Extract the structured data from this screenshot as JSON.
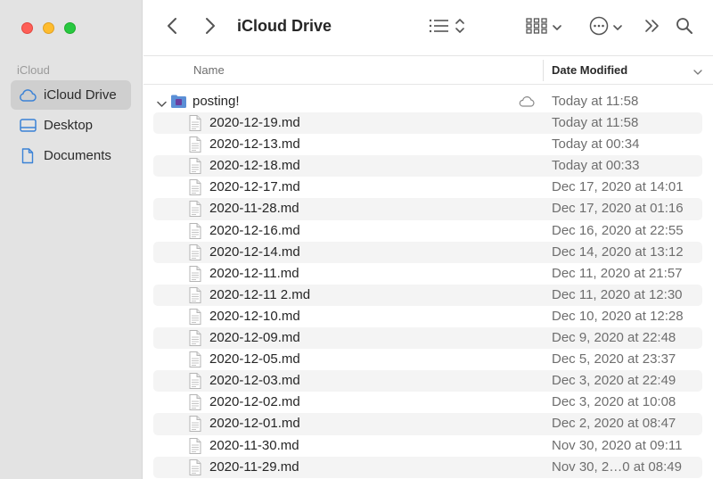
{
  "sidebar": {
    "section_title": "iCloud",
    "items": [
      {
        "label": "iCloud Drive",
        "icon": "cloud-icon",
        "active": true
      },
      {
        "label": "Desktop",
        "icon": "desktop-icon",
        "active": false
      },
      {
        "label": "Documents",
        "icon": "document-icon",
        "active": false
      }
    ]
  },
  "toolbar": {
    "title": "iCloud Drive",
    "back_icon": "chevron-left-icon",
    "forward_icon": "chevron-right-icon",
    "view_icon": "list-view-icon",
    "group_icon": "grid-view-icon",
    "action_icon": "more-icon",
    "overflow_icon": "double-chevron-icon",
    "search_icon": "search-icon"
  },
  "columns": {
    "name": "Name",
    "date": "Date Modified"
  },
  "colors": {
    "sidebar_bg": "#e3e3e3",
    "accent_folder": "#5b8fd6",
    "stripe": "#f4f4f4"
  },
  "rows": [
    {
      "type": "folder",
      "name": "posting!",
      "date": "Today at 11:58",
      "expanded": true,
      "cloud": true
    },
    {
      "type": "file",
      "name": "2020-12-19.md",
      "date": "Today at 11:58"
    },
    {
      "type": "file",
      "name": "2020-12-13.md",
      "date": "Today at 00:34"
    },
    {
      "type": "file",
      "name": "2020-12-18.md",
      "date": "Today at 00:33"
    },
    {
      "type": "file",
      "name": "2020-12-17.md",
      "date": "Dec 17, 2020 at 14:01"
    },
    {
      "type": "file",
      "name": "2020-11-28.md",
      "date": "Dec 17, 2020 at 01:16"
    },
    {
      "type": "file",
      "name": "2020-12-16.md",
      "date": "Dec 16, 2020 at 22:55"
    },
    {
      "type": "file",
      "name": "2020-12-14.md",
      "date": "Dec 14, 2020 at 13:12"
    },
    {
      "type": "file",
      "name": "2020-12-11.md",
      "date": "Dec 11, 2020 at 21:57"
    },
    {
      "type": "file",
      "name": "2020-12-11 2.md",
      "date": "Dec 11, 2020 at 12:30"
    },
    {
      "type": "file",
      "name": "2020-12-10.md",
      "date": "Dec 10, 2020 at 12:28"
    },
    {
      "type": "file",
      "name": "2020-12-09.md",
      "date": "Dec 9, 2020 at 22:48"
    },
    {
      "type": "file",
      "name": "2020-12-05.md",
      "date": "Dec 5, 2020 at 23:37"
    },
    {
      "type": "file",
      "name": "2020-12-03.md",
      "date": "Dec 3, 2020 at 22:49"
    },
    {
      "type": "file",
      "name": "2020-12-02.md",
      "date": "Dec 3, 2020 at 10:08"
    },
    {
      "type": "file",
      "name": "2020-12-01.md",
      "date": "Dec 2, 2020 at 08:47"
    },
    {
      "type": "file",
      "name": "2020-11-30.md",
      "date": "Nov 30, 2020 at 09:11"
    },
    {
      "type": "file",
      "name": "2020-11-29.md",
      "date": "Nov 30, 2…0 at 08:49"
    }
  ]
}
